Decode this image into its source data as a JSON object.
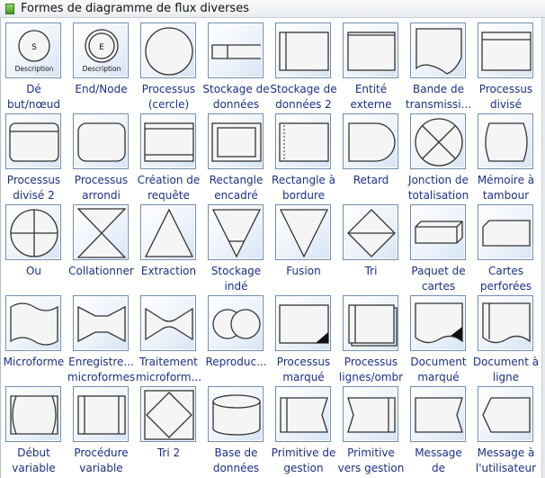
{
  "panel": {
    "title": "Formes de diagramme de flux diverses",
    "icon": "stencil-icon"
  },
  "shapes": [
    {
      "icon": "start-node",
      "lines": [
        "Dé",
        "but/nœud"
      ],
      "glyph": "S",
      "sub": "Description"
    },
    {
      "icon": "end-node",
      "lines": [
        "End/Node",
        ""
      ],
      "glyph": "E",
      "sub": "Description"
    },
    {
      "icon": "circle",
      "lines": [
        "Processus",
        "(cercle)"
      ]
    },
    {
      "icon": "data-store",
      "lines": [
        "Stockage de",
        "données"
      ]
    },
    {
      "icon": "data-store-2",
      "lines": [
        "Stockage de",
        "données 2"
      ]
    },
    {
      "icon": "external-entity",
      "lines": [
        "Entité",
        "externe"
      ]
    },
    {
      "icon": "tape",
      "lines": [
        "Bande de",
        "transmissi..."
      ]
    },
    {
      "icon": "divided-process",
      "lines": [
        "Processus",
        "divisé"
      ]
    },
    {
      "icon": "divided-process-2",
      "lines": [
        "Processus",
        "divisé 2"
      ]
    },
    {
      "icon": "rounded-process",
      "lines": [
        "Processus",
        "arrondi"
      ]
    },
    {
      "icon": "query",
      "lines": [
        "Création de",
        "requête"
      ]
    },
    {
      "icon": "framed-rect",
      "lines": [
        "Rectangle",
        "encadré"
      ]
    },
    {
      "icon": "dashed-rect",
      "lines": [
        "Rectangle à",
        "bordure"
      ]
    },
    {
      "icon": "delay",
      "lines": [
        "Retard",
        ""
      ]
    },
    {
      "icon": "summing-junction",
      "lines": [
        "Jonction de",
        "totalisation"
      ]
    },
    {
      "icon": "drum",
      "lines": [
        "Mémoire à",
        "tambour"
      ]
    },
    {
      "icon": "or",
      "lines": [
        "Ou",
        ""
      ]
    },
    {
      "icon": "collate",
      "lines": [
        "Collationner",
        ""
      ]
    },
    {
      "icon": "extract",
      "lines": [
        "Extraction",
        ""
      ]
    },
    {
      "icon": "offline-storage",
      "lines": [
        "Stockage",
        "indé"
      ]
    },
    {
      "icon": "merge",
      "lines": [
        "Fusion",
        ""
      ]
    },
    {
      "icon": "sort",
      "lines": [
        "Tri",
        ""
      ]
    },
    {
      "icon": "card-deck",
      "lines": [
        "Paquet de",
        "cartes"
      ]
    },
    {
      "icon": "punched-card",
      "lines": [
        "Cartes",
        "perforées"
      ]
    },
    {
      "icon": "microform",
      "lines": [
        "Microforme",
        ""
      ]
    },
    {
      "icon": "microform-record",
      "lines": [
        "Enregistre...",
        "microformes"
      ]
    },
    {
      "icon": "microform-process",
      "lines": [
        "Traitement",
        "microform..."
      ]
    },
    {
      "icon": "reproduce",
      "lines": [
        "Reproduc...",
        ""
      ]
    },
    {
      "icon": "marked-process",
      "lines": [
        "Processus",
        "marqué"
      ]
    },
    {
      "icon": "lined-process",
      "lines": [
        "Processus",
        "lignes/ombr"
      ]
    },
    {
      "icon": "marked-document",
      "lines": [
        "Document",
        "marqué"
      ]
    },
    {
      "icon": "lined-document",
      "lines": [
        "Document à",
        "ligne"
      ]
    },
    {
      "icon": "variable-start",
      "lines": [
        "Début",
        "variable"
      ]
    },
    {
      "icon": "variable-procedure",
      "lines": [
        "Procédure",
        "variable"
      ]
    },
    {
      "icon": "sort-2",
      "lines": [
        "Tri 2",
        ""
      ]
    },
    {
      "icon": "database",
      "lines": [
        "Base de",
        "données"
      ]
    },
    {
      "icon": "primitive-management",
      "lines": [
        "Primitive de",
        "gestion"
      ]
    },
    {
      "icon": "primitive-to-management",
      "lines": [
        "Primitive",
        "vers gestion"
      ]
    },
    {
      "icon": "message-from",
      "lines": [
        "Message",
        "de"
      ]
    },
    {
      "icon": "message-to-user",
      "lines": [
        "Message à",
        "l'utilisateur"
      ]
    }
  ]
}
